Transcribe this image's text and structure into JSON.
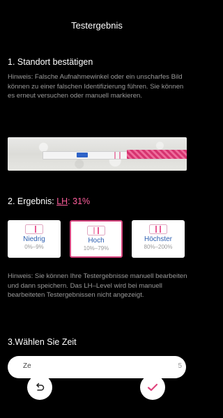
{
  "header": {
    "title": "Testergebnis"
  },
  "section1": {
    "heading": "1. Standort bestätigen",
    "hint": "Hinweis: Falsche Aufnahmewinkel oder ein unscharfes Bild können zu einer falschen Identifizierung führen. Sie können es erneut versuchen oder manuell markieren."
  },
  "section2": {
    "heading_prefix": "2. Ergebnis: ",
    "lh_label": "LH",
    "percent": ": 31%",
    "cards": [
      {
        "label": "Niedrig",
        "range": "0%–9%"
      },
      {
        "label": "Hoch",
        "range": "10%–79%"
      },
      {
        "label": "Höchster",
        "range": "80%–200%"
      }
    ],
    "hint": "Hinweis: Sie können Ihre Testergebnisse manuell bearbeiten und dann speichern. Das LH–Level wird bei manuell bearbeiteten Testergebnissen nicht angezeigt."
  },
  "section3": {
    "heading": "3.Wählen Sie Zeit",
    "time_left": "Ze",
    "time_right": "5"
  },
  "icons": {
    "undo": "undo-icon",
    "confirm": "check-icon"
  },
  "colors": {
    "accent": "#d6457e",
    "pink": "#ff5f9d",
    "blue": "#2d5fb0"
  }
}
